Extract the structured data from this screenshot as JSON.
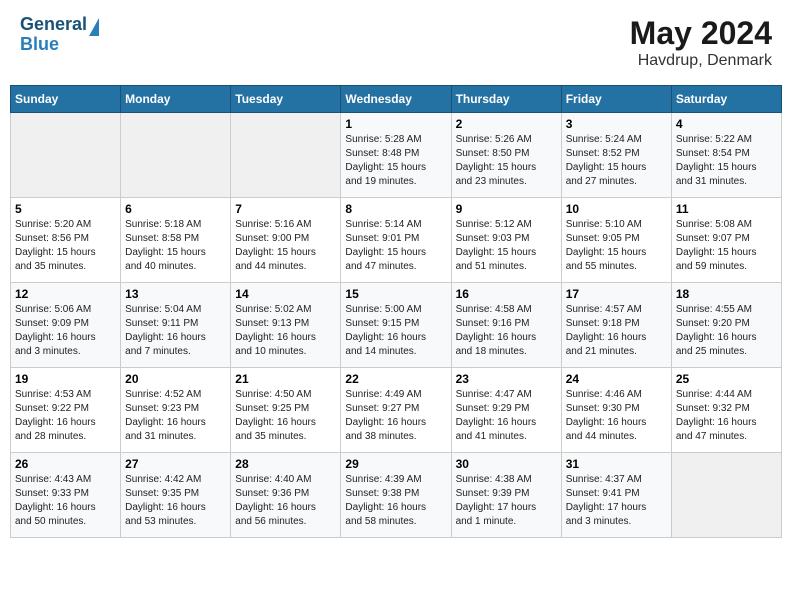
{
  "header": {
    "logo_line1": "General",
    "logo_line2": "Blue",
    "month_year": "May 2024",
    "location": "Havdrup, Denmark"
  },
  "weekdays": [
    "Sunday",
    "Monday",
    "Tuesday",
    "Wednesday",
    "Thursday",
    "Friday",
    "Saturday"
  ],
  "weeks": [
    [
      {
        "day": "",
        "info": ""
      },
      {
        "day": "",
        "info": ""
      },
      {
        "day": "",
        "info": ""
      },
      {
        "day": "1",
        "info": "Sunrise: 5:28 AM\nSunset: 8:48 PM\nDaylight: 15 hours\nand 19 minutes."
      },
      {
        "day": "2",
        "info": "Sunrise: 5:26 AM\nSunset: 8:50 PM\nDaylight: 15 hours\nand 23 minutes."
      },
      {
        "day": "3",
        "info": "Sunrise: 5:24 AM\nSunset: 8:52 PM\nDaylight: 15 hours\nand 27 minutes."
      },
      {
        "day": "4",
        "info": "Sunrise: 5:22 AM\nSunset: 8:54 PM\nDaylight: 15 hours\nand 31 minutes."
      }
    ],
    [
      {
        "day": "5",
        "info": "Sunrise: 5:20 AM\nSunset: 8:56 PM\nDaylight: 15 hours\nand 35 minutes."
      },
      {
        "day": "6",
        "info": "Sunrise: 5:18 AM\nSunset: 8:58 PM\nDaylight: 15 hours\nand 40 minutes."
      },
      {
        "day": "7",
        "info": "Sunrise: 5:16 AM\nSunset: 9:00 PM\nDaylight: 15 hours\nand 44 minutes."
      },
      {
        "day": "8",
        "info": "Sunrise: 5:14 AM\nSunset: 9:01 PM\nDaylight: 15 hours\nand 47 minutes."
      },
      {
        "day": "9",
        "info": "Sunrise: 5:12 AM\nSunset: 9:03 PM\nDaylight: 15 hours\nand 51 minutes."
      },
      {
        "day": "10",
        "info": "Sunrise: 5:10 AM\nSunset: 9:05 PM\nDaylight: 15 hours\nand 55 minutes."
      },
      {
        "day": "11",
        "info": "Sunrise: 5:08 AM\nSunset: 9:07 PM\nDaylight: 15 hours\nand 59 minutes."
      }
    ],
    [
      {
        "day": "12",
        "info": "Sunrise: 5:06 AM\nSunset: 9:09 PM\nDaylight: 16 hours\nand 3 minutes."
      },
      {
        "day": "13",
        "info": "Sunrise: 5:04 AM\nSunset: 9:11 PM\nDaylight: 16 hours\nand 7 minutes."
      },
      {
        "day": "14",
        "info": "Sunrise: 5:02 AM\nSunset: 9:13 PM\nDaylight: 16 hours\nand 10 minutes."
      },
      {
        "day": "15",
        "info": "Sunrise: 5:00 AM\nSunset: 9:15 PM\nDaylight: 16 hours\nand 14 minutes."
      },
      {
        "day": "16",
        "info": "Sunrise: 4:58 AM\nSunset: 9:16 PM\nDaylight: 16 hours\nand 18 minutes."
      },
      {
        "day": "17",
        "info": "Sunrise: 4:57 AM\nSunset: 9:18 PM\nDaylight: 16 hours\nand 21 minutes."
      },
      {
        "day": "18",
        "info": "Sunrise: 4:55 AM\nSunset: 9:20 PM\nDaylight: 16 hours\nand 25 minutes."
      }
    ],
    [
      {
        "day": "19",
        "info": "Sunrise: 4:53 AM\nSunset: 9:22 PM\nDaylight: 16 hours\nand 28 minutes."
      },
      {
        "day": "20",
        "info": "Sunrise: 4:52 AM\nSunset: 9:23 PM\nDaylight: 16 hours\nand 31 minutes."
      },
      {
        "day": "21",
        "info": "Sunrise: 4:50 AM\nSunset: 9:25 PM\nDaylight: 16 hours\nand 35 minutes."
      },
      {
        "day": "22",
        "info": "Sunrise: 4:49 AM\nSunset: 9:27 PM\nDaylight: 16 hours\nand 38 minutes."
      },
      {
        "day": "23",
        "info": "Sunrise: 4:47 AM\nSunset: 9:29 PM\nDaylight: 16 hours\nand 41 minutes."
      },
      {
        "day": "24",
        "info": "Sunrise: 4:46 AM\nSunset: 9:30 PM\nDaylight: 16 hours\nand 44 minutes."
      },
      {
        "day": "25",
        "info": "Sunrise: 4:44 AM\nSunset: 9:32 PM\nDaylight: 16 hours\nand 47 minutes."
      }
    ],
    [
      {
        "day": "26",
        "info": "Sunrise: 4:43 AM\nSunset: 9:33 PM\nDaylight: 16 hours\nand 50 minutes."
      },
      {
        "day": "27",
        "info": "Sunrise: 4:42 AM\nSunset: 9:35 PM\nDaylight: 16 hours\nand 53 minutes."
      },
      {
        "day": "28",
        "info": "Sunrise: 4:40 AM\nSunset: 9:36 PM\nDaylight: 16 hours\nand 56 minutes."
      },
      {
        "day": "29",
        "info": "Sunrise: 4:39 AM\nSunset: 9:38 PM\nDaylight: 16 hours\nand 58 minutes."
      },
      {
        "day": "30",
        "info": "Sunrise: 4:38 AM\nSunset: 9:39 PM\nDaylight: 17 hours\nand 1 minute."
      },
      {
        "day": "31",
        "info": "Sunrise: 4:37 AM\nSunset: 9:41 PM\nDaylight: 17 hours\nand 3 minutes."
      },
      {
        "day": "",
        "info": ""
      }
    ]
  ]
}
